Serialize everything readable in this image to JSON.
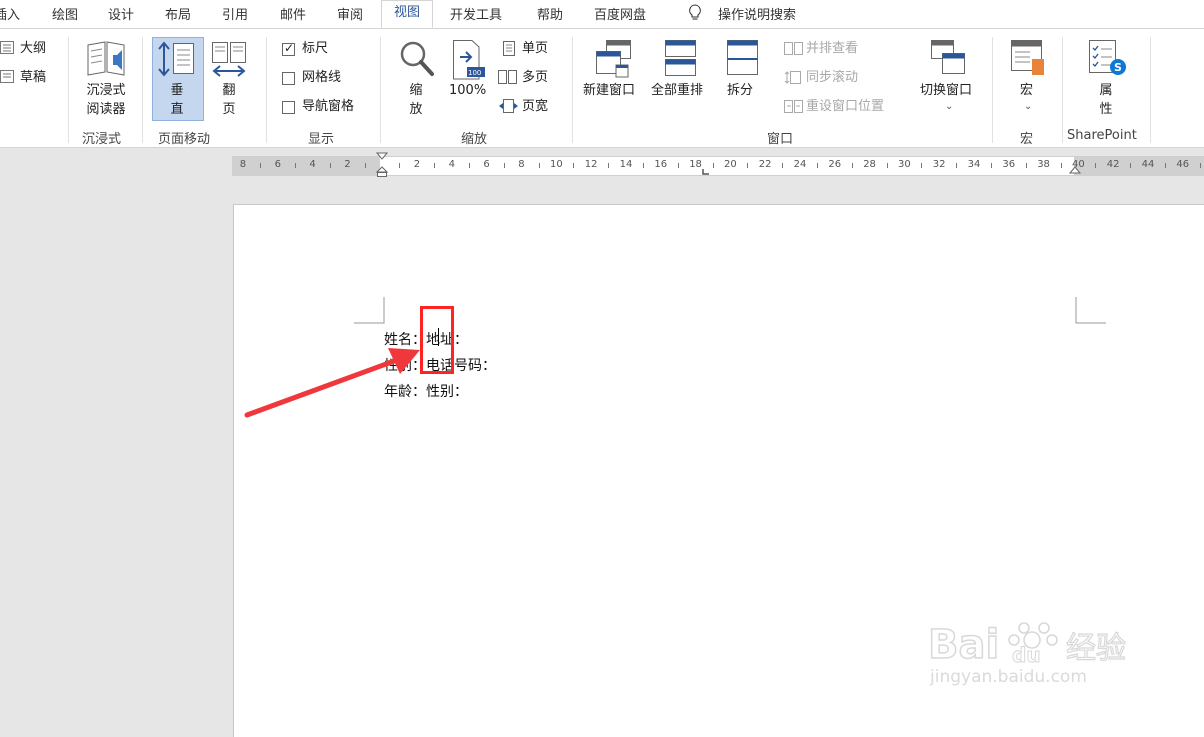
{
  "tabs": [
    {
      "label": "插入",
      "active": false
    },
    {
      "label": "绘图",
      "active": false
    },
    {
      "label": "设计",
      "active": false
    },
    {
      "label": "布局",
      "active": false
    },
    {
      "label": "引用",
      "active": false
    },
    {
      "label": "邮件",
      "active": false
    },
    {
      "label": "审阅",
      "active": false
    },
    {
      "label": "视图",
      "active": true
    },
    {
      "label": "开发工具",
      "active": false
    },
    {
      "label": "帮助",
      "active": false
    },
    {
      "label": "百度网盘",
      "active": false
    }
  ],
  "search_tell": "操作说明搜索",
  "ribbon": {
    "views": {
      "outline": "大纲",
      "draft": "草稿"
    },
    "immersive": {
      "reader": "沉浸式阅读器",
      "group": "沉浸式"
    },
    "page_movement": {
      "vertical": "垂直",
      "side_to_side": "翻页",
      "group": "页面移动"
    },
    "show": {
      "ruler": "标尺",
      "gridlines": "网格线",
      "nav_pane": "导航窗格",
      "group": "显示",
      "ruler_checked": true,
      "gridlines_checked": false,
      "nav_pane_checked": false
    },
    "zoom": {
      "zoom": "缩放",
      "percent": "100%",
      "one_page": "单页",
      "multiple_pages": "多页",
      "page_width": "页宽",
      "group": "缩放"
    },
    "window": {
      "new_window": "新建窗口",
      "arrange_all": "全部重排",
      "split": "拆分",
      "side_by_side": "并排查看",
      "sync_scroll": "同步滚动",
      "reset_position": "重设窗口位置",
      "switch_windows": "切换窗口",
      "group": "窗口"
    },
    "macros": {
      "label": "宏",
      "group": "宏"
    },
    "sharepoint": {
      "label": "属性",
      "group": "SharePoint"
    }
  },
  "ruler": {
    "left_numbers": [
      "8",
      "6",
      "4",
      "2"
    ],
    "right_numbers": [
      "2",
      "4",
      "6",
      "8",
      "10",
      "12",
      "14",
      "16",
      "18",
      "20",
      "22",
      "24",
      "26",
      "28",
      "30",
      "32",
      "34",
      "36",
      "38",
      "40",
      "42",
      "44",
      "46"
    ]
  },
  "document": {
    "lines": [
      "姓名：地址：",
      "性别：电话号码：",
      "年龄：性别："
    ]
  },
  "watermark": {
    "brand": "Baidu经验",
    "url": "jingyan.baidu.com"
  },
  "colors": {
    "accent": "#2b579a",
    "highlight": "#ff2424",
    "arrow": "#f0373c"
  }
}
